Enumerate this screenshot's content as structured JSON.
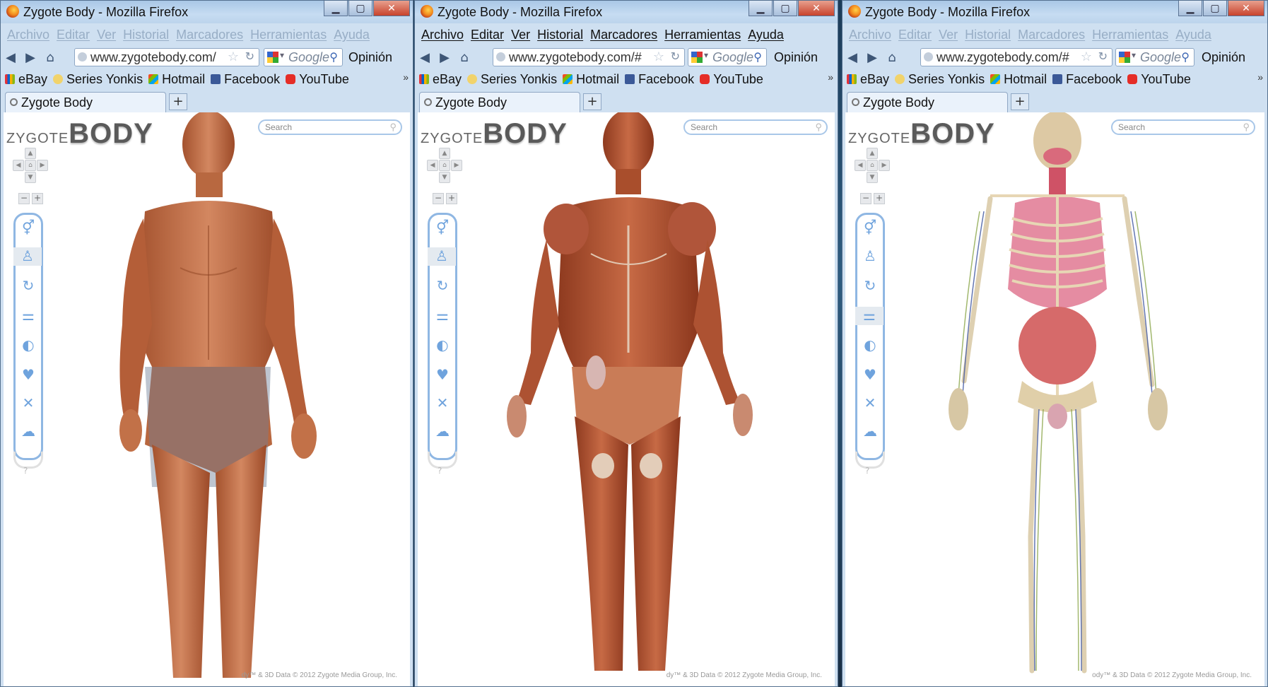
{
  "browser": {
    "window_title": "Zygote Body - Mozilla Firefox",
    "menu": [
      "Archivo",
      "Editar",
      "Ver",
      "Historial",
      "Marcadores",
      "Herramientas",
      "Ayuda"
    ],
    "url_short": "www.zygotebody.com/",
    "url_hash": "www.zygotebody.com/#",
    "search_engine": "Google",
    "feedback": "Opinión",
    "bookmarks": [
      "eBay",
      "Series Yonkis",
      "Hotmail",
      "Facebook",
      "YouTube"
    ],
    "bookmarks_overflow": "»",
    "tab_title": "Zygote Body",
    "new_tab": "+"
  },
  "page": {
    "logo_prefix": "ZYGOTE",
    "logo_main": "BODY",
    "search_placeholder": "Search",
    "help": "?",
    "copyright_1": "dy™ & 3D Data © 2012 Zygote Media Group, Inc.",
    "copyright_2": "dy™ & 3D Data © 2012 Zygote Media Group, Inc.",
    "copyright_3": "ody™ & 3D Data © 2012 Zygote Media Group, Inc.",
    "layer_icons": [
      "gender-toggle-icon",
      "skin-icon",
      "muscle-icon",
      "bone-icon",
      "organ-icon",
      "heart-icon",
      "vessel-icon",
      "brain-icon",
      "opacity-slider-icon"
    ]
  },
  "colors": {
    "layer_accent": "#8fb7e3",
    "skin": "#c4714a",
    "muscle": "#b65a3a",
    "bone": "#e4d3b0",
    "organs": "#d9576b"
  }
}
